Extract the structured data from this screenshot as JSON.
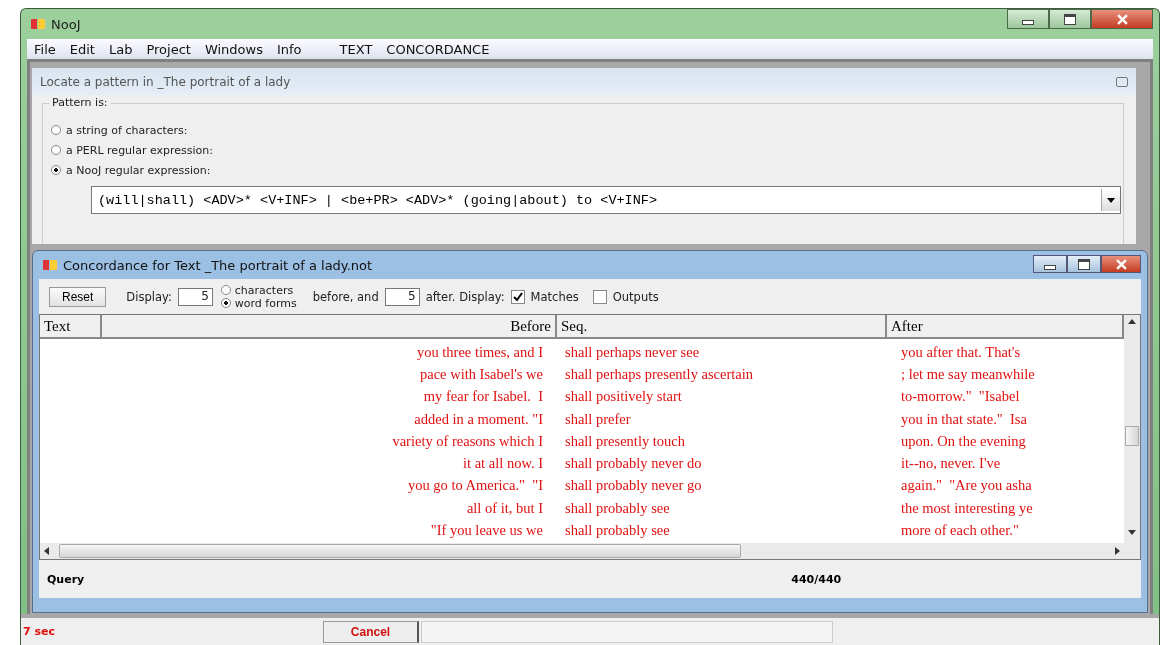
{
  "window": {
    "title": "NooJ"
  },
  "menu": [
    "File",
    "Edit",
    "Lab",
    "Project",
    "Windows",
    "Info",
    "TEXT",
    "CONCORDANCE"
  ],
  "locate_panel": {
    "title": "Locate a pattern in _The portrait of a lady",
    "group_label": "Pattern is:",
    "options": [
      {
        "label": "a string of characters:",
        "selected": false
      },
      {
        "label": "a PERL regular expression:",
        "selected": false
      },
      {
        "label": "a NooJ regular expression:",
        "selected": true
      }
    ],
    "pattern": "(will|shall) <ADV>* <V+INF> | <be+PR> <ADV>* (going|about) to <V+INF>"
  },
  "concordance": {
    "title": "Concordance for Text _The portrait of a lady.not",
    "reset": "Reset",
    "display_label": "Display:",
    "before_count": "5",
    "units": [
      {
        "label": "characters",
        "selected": false
      },
      {
        "label": "word forms",
        "selected": true
      }
    ],
    "between_label": "before, and",
    "after_count": "5",
    "after_label": "after. Display:",
    "checks": [
      {
        "label": "Matches",
        "checked": true
      },
      {
        "label": "Outputs",
        "checked": false
      }
    ],
    "columns": [
      "Text",
      "Before",
      "Seq.",
      "After"
    ],
    "rows": [
      {
        "before": "you three times, and I",
        "seq": "shall perhaps never see",
        "after": "you after that. That's"
      },
      {
        "before": "pace with Isabel's we",
        "seq": "shall perhaps presently ascertain",
        "after": "; let me say meanwhile"
      },
      {
        "before": "my fear for Isabel.  I",
        "seq": "shall positively start",
        "after": "to-morrow.\"  \"Isabel"
      },
      {
        "before": "added in a moment. \"I",
        "seq": "shall prefer",
        "after": "you in that state.\"  Isa"
      },
      {
        "before": "variety of reasons which I",
        "seq": "shall presently touch",
        "after": "upon. On the evening"
      },
      {
        "before": "it at all now. I",
        "seq": "shall probably never do",
        "after": "it--no, never. I've"
      },
      {
        "before": "you go to America.\"  \"I",
        "seq": "shall probably never go",
        "after": "again.\"  \"Are you asha"
      },
      {
        "before": "all of it, but I",
        "seq": "shall probably see",
        "after": "the most interesting ye"
      },
      {
        "before": "\"If you leave us we",
        "seq": "shall probably see",
        "after": "more of each other.\""
      }
    ],
    "query_label": "Query",
    "count": "440/440"
  },
  "status_bar": {
    "time": "7 sec",
    "cancel": "Cancel"
  }
}
